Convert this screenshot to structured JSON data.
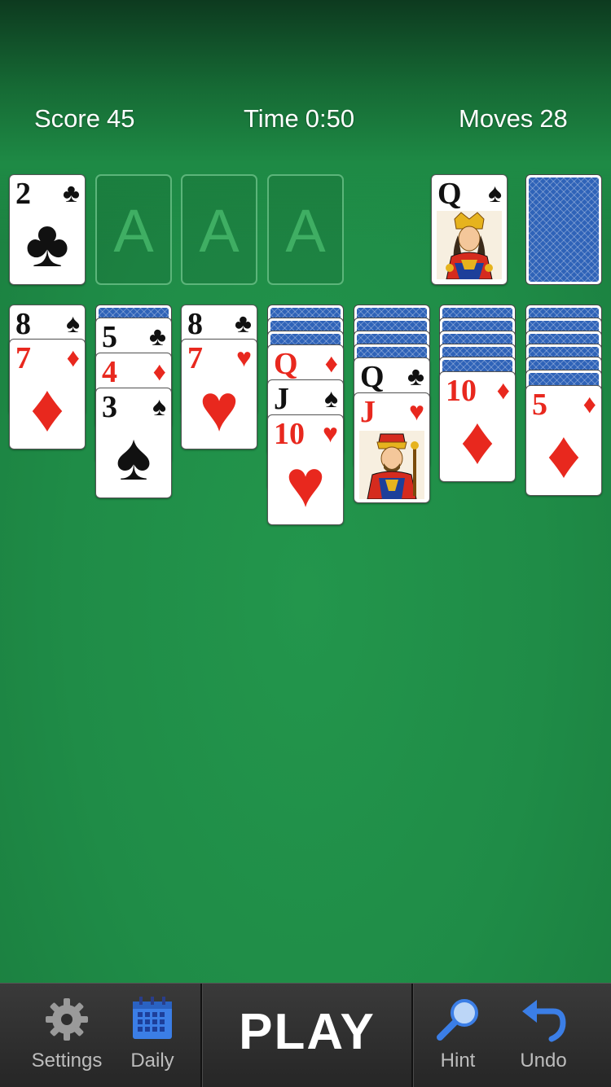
{
  "hud": {
    "score_label": "Score",
    "score": "45",
    "time_label": "Time",
    "time": "0:50",
    "moves_label": "Moves",
    "moves": "28"
  },
  "foundations": [
    {
      "rank": "2",
      "suit": "♣"
    },
    {
      "rank": "A"
    },
    {
      "rank": "A"
    },
    {
      "rank": "A"
    }
  ],
  "waste": {
    "rank": "Q",
    "suit": "♠",
    "face": "queen"
  },
  "stock": {
    "face_down": true
  },
  "tableau": [
    {
      "hidden": 0,
      "cards": [
        {
          "rank": "8",
          "suit": "♠"
        },
        {
          "rank": "7",
          "suit": "♦"
        }
      ]
    },
    {
      "hidden": 1,
      "cards": [
        {
          "rank": "5",
          "suit": "♣"
        },
        {
          "rank": "4",
          "suit": "♦"
        },
        {
          "rank": "3",
          "suit": "♠"
        }
      ]
    },
    {
      "hidden": 0,
      "cards": [
        {
          "rank": "8",
          "suit": "♣"
        },
        {
          "rank": "7",
          "suit": "♥"
        }
      ]
    },
    {
      "hidden": 3,
      "cards": [
        {
          "rank": "Q",
          "suit": "♦"
        },
        {
          "rank": "J",
          "suit": "♠"
        },
        {
          "rank": "10",
          "suit": "♥"
        }
      ]
    },
    {
      "hidden": 4,
      "cards": [
        {
          "rank": "Q",
          "suit": "♣"
        },
        {
          "rank": "J",
          "suit": "♥",
          "face": "jack"
        }
      ]
    },
    {
      "hidden": 5,
      "cards": [
        {
          "rank": "10",
          "suit": "♦"
        }
      ]
    },
    {
      "hidden": 6,
      "cards": [
        {
          "rank": "5",
          "suit": "♦"
        }
      ]
    }
  ],
  "toolbar": {
    "settings_label": "Settings",
    "daily_label": "Daily",
    "play_label": "PLAY",
    "hint_label": "Hint",
    "undo_label": "Undo"
  },
  "icons": {
    "settings": "gear-icon",
    "daily": "calendar-icon",
    "hint": "magnifier-icon",
    "undo": "undo-arrow-icon"
  },
  "colors": {
    "felt": "#1f8c47",
    "red_suit": "#e8281e",
    "card_back": "#2f63b8",
    "accent_blue": "#3b7ee6"
  }
}
